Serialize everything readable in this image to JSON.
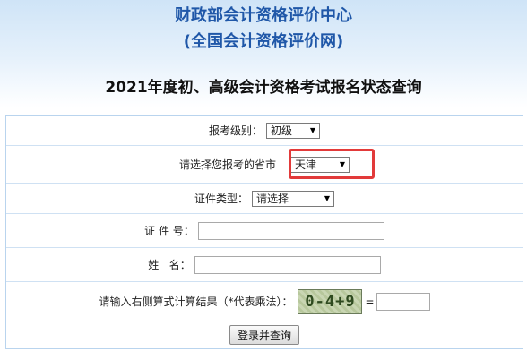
{
  "header": {
    "org_line1": "财政部会计资格评价中心",
    "org_line2": "(全国会计资格评价网)",
    "title": "2021年度初、高级会计资格考试报名状态查询"
  },
  "form": {
    "level": {
      "label": "报考级别：",
      "value": "初级"
    },
    "province": {
      "label": "请选择您报考的省市",
      "value": "天津",
      "highlight_color": "#e23a3a"
    },
    "id_type": {
      "label": "证件类型：",
      "value": "请选择"
    },
    "id_number": {
      "label": "证 件 号：",
      "value": ""
    },
    "name": {
      "label": "姓   名：",
      "value": ""
    },
    "captcha": {
      "label": "请输入右侧算式计算结果（*代表乘法）：",
      "expression": "0-4+9",
      "equals": "=",
      "answer": ""
    },
    "submit_label": "登录并查询"
  },
  "colors": {
    "header_title": "#1f57a8",
    "border": "#b9d4ee"
  }
}
